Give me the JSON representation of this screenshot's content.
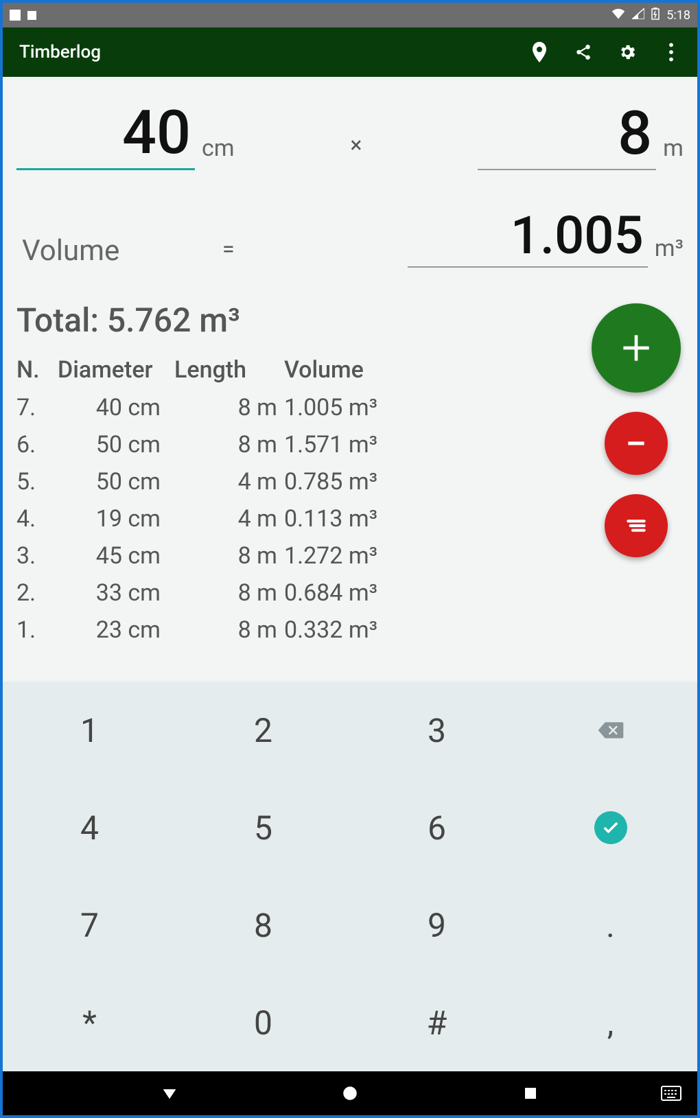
{
  "statusbar": {
    "time": "5:18"
  },
  "appbar": {
    "title": "Timberlog"
  },
  "inputs": {
    "diameter_value": "40",
    "diameter_unit": "cm",
    "multiply_symbol": "×",
    "length_value": "8",
    "length_unit": "m"
  },
  "volume": {
    "label": "Volume",
    "equals": "=",
    "value": "1.005",
    "unit": "m³"
  },
  "total_line": "Total: 5.762 m³",
  "table": {
    "headers": {
      "n": "N.",
      "diameter": "Diameter",
      "length": "Length",
      "volume": "Volume"
    },
    "rows": [
      {
        "n": "7.",
        "diameter": "40 cm",
        "length": "8 m",
        "volume": "1.005 m³"
      },
      {
        "n": "6.",
        "diameter": "50 cm",
        "length": "8 m",
        "volume": "1.571 m³"
      },
      {
        "n": "5.",
        "diameter": "50 cm",
        "length": "4 m",
        "volume": "0.785 m³"
      },
      {
        "n": "4.",
        "diameter": "19 cm",
        "length": "4 m",
        "volume": "0.113 m³"
      },
      {
        "n": "3.",
        "diameter": "45 cm",
        "length": "8 m",
        "volume": "1.272 m³"
      },
      {
        "n": "2.",
        "diameter": "33 cm",
        "length": "8 m",
        "volume": "0.684 m³"
      },
      {
        "n": "1.",
        "diameter": "23 cm",
        "length": "8 m",
        "volume": "0.332 m³"
      }
    ]
  },
  "keypad": {
    "keys": [
      "1",
      "2",
      "3",
      "backspace",
      "4",
      "5",
      "6",
      "enter",
      "7",
      "8",
      "9",
      ".",
      "*",
      "0",
      "#",
      ","
    ]
  }
}
